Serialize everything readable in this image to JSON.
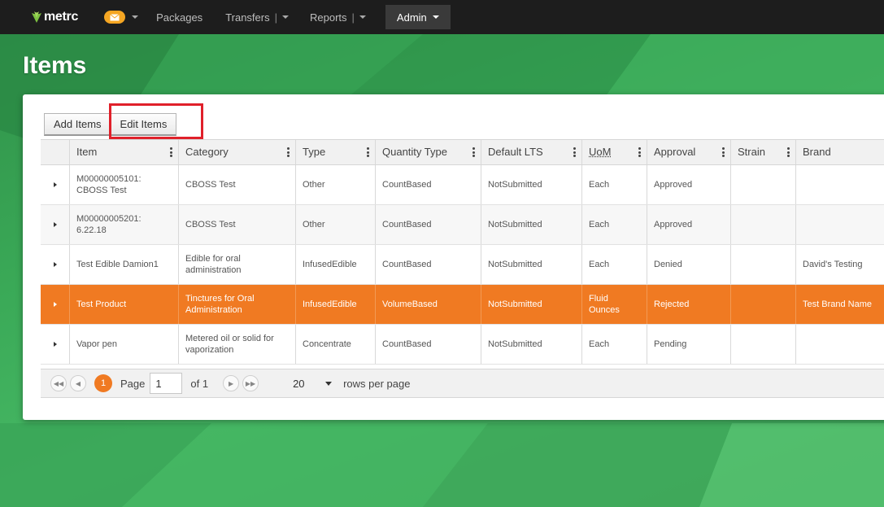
{
  "nav": {
    "brand": "metrc",
    "items": [
      {
        "label": "Packages",
        "dropdown": false
      },
      {
        "label": "Transfers",
        "dropdown": true
      },
      {
        "label": "Reports",
        "dropdown": true
      }
    ],
    "admin_label": "Admin"
  },
  "page": {
    "title": "Items"
  },
  "toolbar": {
    "add_label": "Add Items",
    "edit_label": "Edit Items"
  },
  "grid": {
    "columns": [
      "Item",
      "Category",
      "Type",
      "Quantity Type",
      "Default LTS",
      "UoM",
      "Approval",
      "Strain",
      "Brand"
    ],
    "rows": [
      {
        "item": "M00000005101: CBOSS Test",
        "category": "CBOSS Test",
        "type": "Other",
        "qty": "CountBased",
        "lts": "NotSubmitted",
        "uom": "Each",
        "approval": "Approved",
        "strain": "",
        "brand": ""
      },
      {
        "item": "M00000005201: 6.22.18",
        "category": "CBOSS Test",
        "type": "Other",
        "qty": "CountBased",
        "lts": "NotSubmitted",
        "uom": "Each",
        "approval": "Approved",
        "strain": "",
        "brand": ""
      },
      {
        "item": "Test Edible Damion1",
        "category": "Edible for oral administration",
        "type": "InfusedEdible",
        "qty": "CountBased",
        "lts": "NotSubmitted",
        "uom": "Each",
        "approval": "Denied",
        "strain": "",
        "brand": "David's Testing"
      },
      {
        "item": "Test Product",
        "category": "Tinctures for Oral Administration",
        "type": "InfusedEdible",
        "qty": "VolumeBased",
        "lts": "NotSubmitted",
        "uom": "Fluid Ounces",
        "approval": "Rejected",
        "strain": "",
        "brand": "Test Brand Name"
      },
      {
        "item": "Vapor pen",
        "category": "Metered oil or solid for vaporization",
        "type": "Concentrate",
        "qty": "CountBased",
        "lts": "NotSubmitted",
        "uom": "Each",
        "approval": "Pending",
        "strain": "",
        "brand": ""
      }
    ],
    "selected_row": 3
  },
  "pager": {
    "current_page": "1",
    "page_label": "Page",
    "page_value": "1",
    "of_label": "of 1",
    "page_size": "20",
    "rows_label": "rows per page"
  },
  "colors": {
    "accent": "#f07a22",
    "navbar": "#1d1d1d",
    "highlight": "#e0202a"
  }
}
